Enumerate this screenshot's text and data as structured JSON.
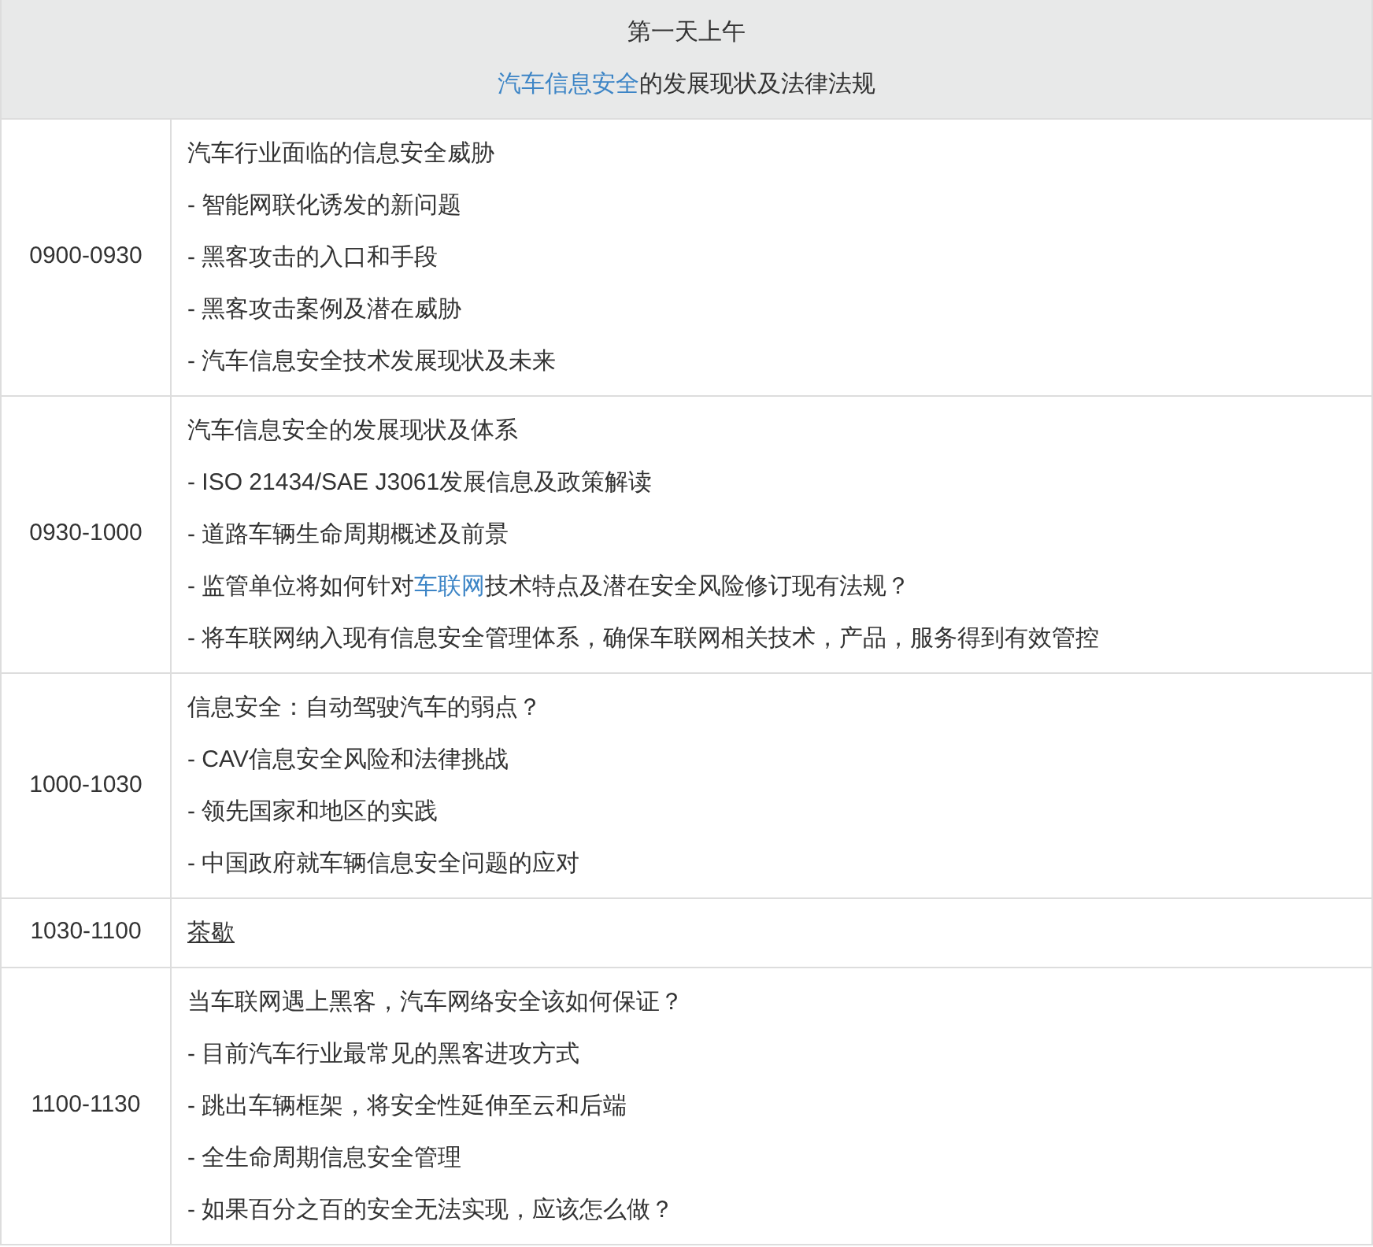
{
  "header": {
    "title": "第一天上午",
    "subtitle": [
      {
        "kind": "link",
        "text": "汽车信息安全"
      },
      {
        "kind": "plain",
        "text": "的发展现状及法律法规"
      }
    ]
  },
  "rows": [
    {
      "time": "0900-0930",
      "lines": [
        [
          {
            "kind": "plain",
            "text": "汽车行业面临的信息安全威胁"
          }
        ],
        [
          {
            "kind": "plain",
            "text": "- 智能网联化诱发的新问题"
          }
        ],
        [
          {
            "kind": "plain",
            "text": "- 黑客攻击的入口和手段"
          }
        ],
        [
          {
            "kind": "plain",
            "text": "- 黑客攻击案例及潜在威胁"
          }
        ],
        [
          {
            "kind": "plain",
            "text": "- 汽车信息安全技术发展现状及未来"
          }
        ]
      ]
    },
    {
      "time": "0930-1000",
      "lines": [
        [
          {
            "kind": "plain",
            "text": "汽车信息安全的发展现状及体系"
          }
        ],
        [
          {
            "kind": "plain",
            "text": "- ISO 21434/SAE J3061发展信息及政策解读"
          }
        ],
        [
          {
            "kind": "plain",
            "text": "- 道路车辆生命周期概述及前景"
          }
        ],
        [
          {
            "kind": "plain",
            "text": "- 监管单位将如何针对"
          },
          {
            "kind": "link",
            "text": "车联网"
          },
          {
            "kind": "plain",
            "text": "技术特点及潜在安全风险修订现有法规？"
          }
        ],
        [
          {
            "kind": "plain",
            "text": "- 将车联网纳入现有信息安全管理体系，确保车联网相关技术，产品，服务得到有效管控"
          }
        ]
      ]
    },
    {
      "time": "1000-1030",
      "lines": [
        [
          {
            "kind": "plain",
            "text": "信息安全：自动驾驶汽车的弱点？"
          }
        ],
        [
          {
            "kind": "plain",
            "text": "- CAV信息安全风险和法律挑战"
          }
        ],
        [
          {
            "kind": "plain",
            "text": "- 领先国家和地区的实践"
          }
        ],
        [
          {
            "kind": "plain",
            "text": "- 中国政府就车辆信息安全问题的应对"
          }
        ]
      ]
    },
    {
      "time": "1030-1100",
      "lines": [
        [
          {
            "kind": "underlined",
            "text": "茶歇"
          }
        ]
      ]
    },
    {
      "time": "1100-1130",
      "lines": [
        [
          {
            "kind": "plain",
            "text": "当车联网遇上黑客，汽车网络安全该如何保证？"
          }
        ],
        [
          {
            "kind": "plain",
            "text": "- 目前汽车行业最常见的黑客进攻方式"
          }
        ],
        [
          {
            "kind": "plain",
            "text": "- 跳出车辆框架，将安全性延伸至云和后端"
          }
        ],
        [
          {
            "kind": "plain",
            "text": "- 全生命周期信息安全管理"
          }
        ],
        [
          {
            "kind": "plain",
            "text": "- 如果百分之百的安全无法实现，应该怎么做？"
          }
        ]
      ]
    }
  ]
}
